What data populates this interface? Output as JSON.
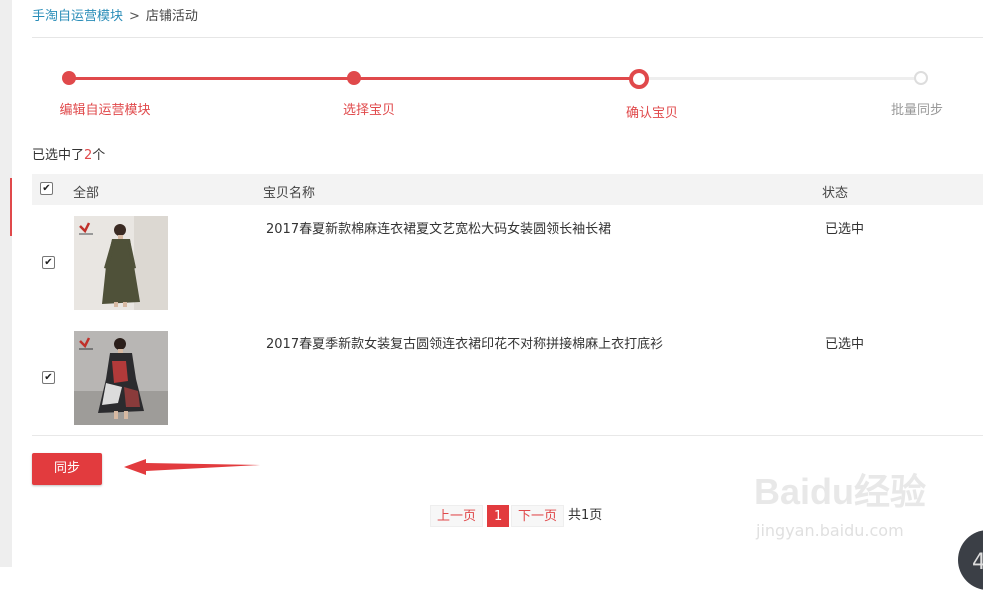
{
  "breadcrumb": {
    "link": "手淘自运营模块",
    "separator": ">",
    "current": "店铺活动"
  },
  "steps": [
    {
      "label": "编辑自运营模块",
      "state": "done"
    },
    {
      "label": "选择宝贝",
      "state": "done"
    },
    {
      "label": "确认宝贝",
      "state": "current"
    },
    {
      "label": "批量同步",
      "state": "todo"
    }
  ],
  "selection": {
    "prefix": "已选中了",
    "count": "2",
    "suffix": "个"
  },
  "table": {
    "headers": {
      "all": "全部",
      "name": "宝贝名称",
      "status": "状态"
    },
    "rows": [
      {
        "title": "2017春夏新款棉麻连衣裙夏文艺宽松大码女装圆领长袖长裙",
        "status": "已选中",
        "checked": true
      },
      {
        "title": "2017春夏季新款女装复古圆领连衣裙印花不对称拼接棉麻上衣打底衫",
        "status": "已选中",
        "checked": true
      }
    ]
  },
  "sync_button": "同步",
  "pagination": {
    "prev": "上一页",
    "current": "1",
    "next": "下一页",
    "total": "共1页"
  },
  "watermark": {
    "logo": "Baidu经验",
    "url": "jingyan.baidu.com"
  },
  "corner_badge": "4",
  "colors": {
    "accent": "#e0494b",
    "link": "#2a8db8",
    "muted": "#e6e6e6"
  }
}
